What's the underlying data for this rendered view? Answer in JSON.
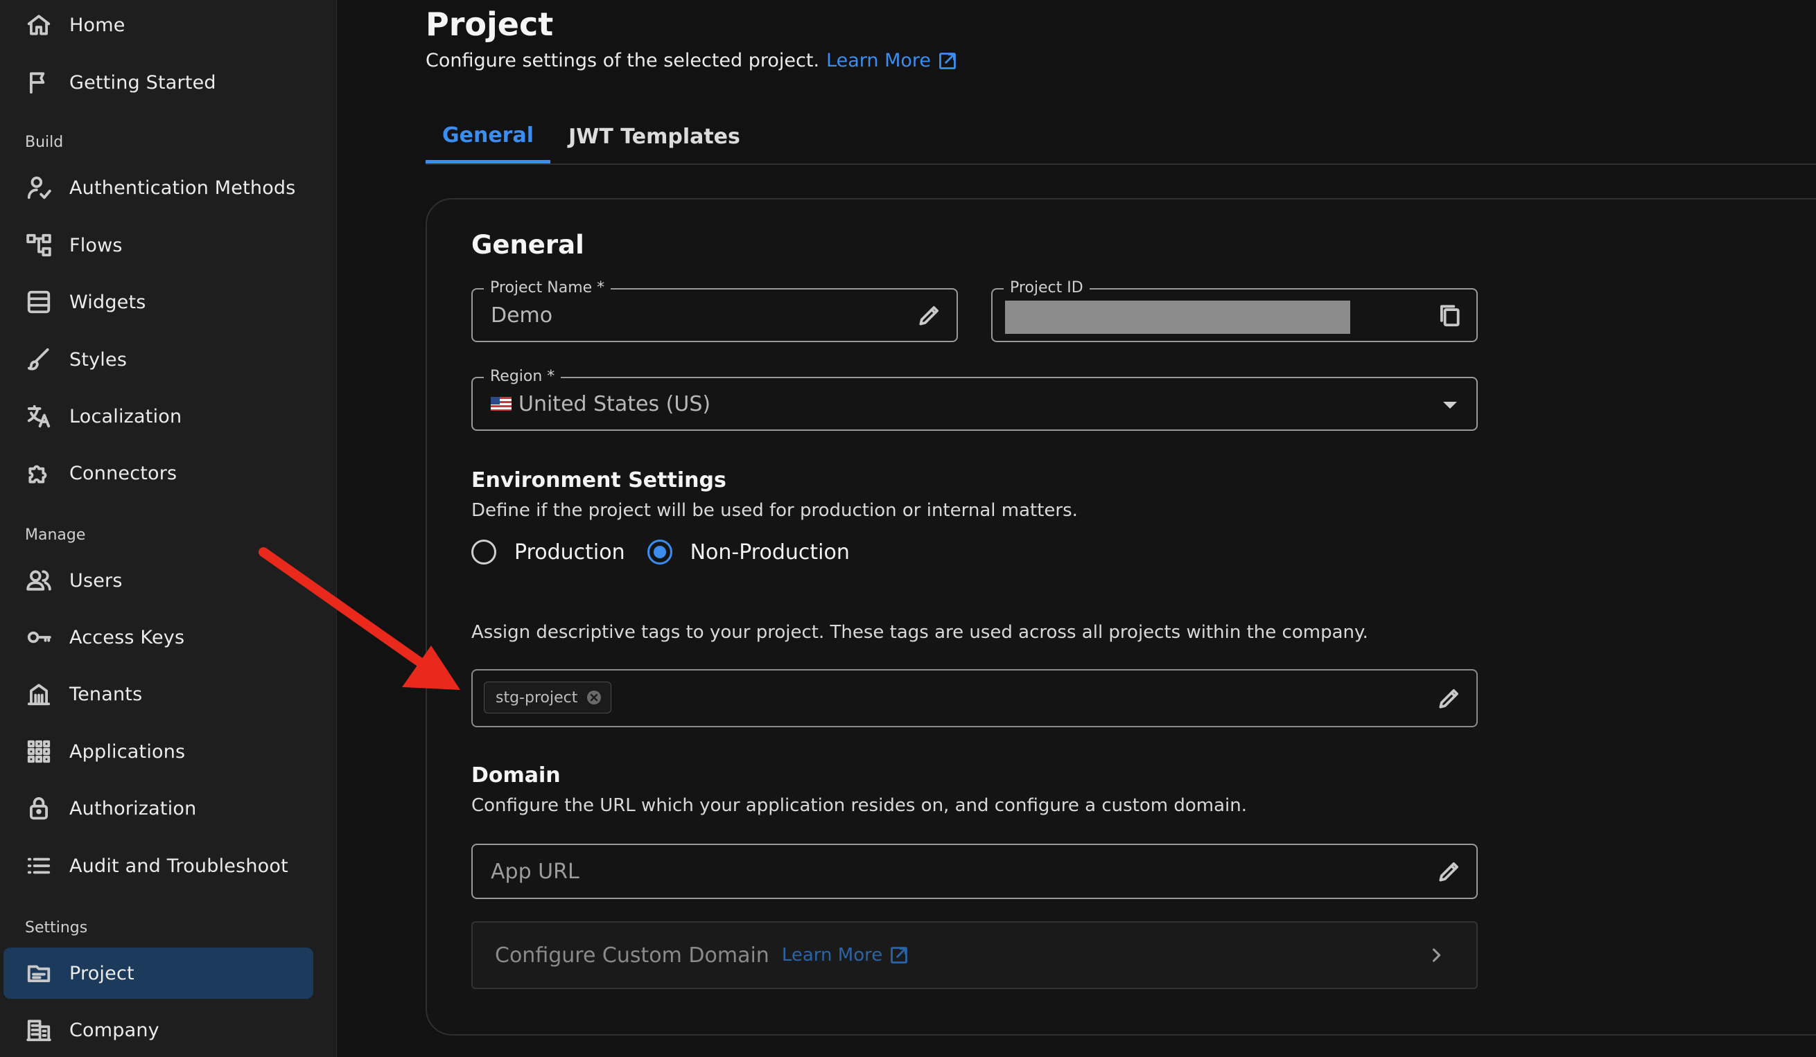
{
  "sidebar": {
    "top_items": [
      {
        "label": "Home",
        "icon": "home-icon"
      },
      {
        "label": "Getting Started",
        "icon": "flag-icon"
      }
    ],
    "sections": [
      {
        "label": "Build",
        "items": [
          {
            "label": "Authentication Methods",
            "icon": "user-check-icon"
          },
          {
            "label": "Flows",
            "icon": "flow-tree-icon"
          },
          {
            "label": "Widgets",
            "icon": "widget-list-icon"
          },
          {
            "label": "Styles",
            "icon": "brush-icon"
          },
          {
            "label": "Localization",
            "icon": "translate-icon"
          },
          {
            "label": "Connectors",
            "icon": "puzzle-icon"
          }
        ]
      },
      {
        "label": "Manage",
        "items": [
          {
            "label": "Users",
            "icon": "users-icon"
          },
          {
            "label": "Access Keys",
            "icon": "key-icon"
          },
          {
            "label": "Tenants",
            "icon": "building-columns-icon"
          },
          {
            "label": "Applications",
            "icon": "grid-icon"
          },
          {
            "label": "Authorization",
            "icon": "lock-icon"
          },
          {
            "label": "Audit and Troubleshoot",
            "icon": "list-icon"
          }
        ]
      },
      {
        "label": "Settings",
        "items": [
          {
            "label": "Project",
            "icon": "folder-icon",
            "active": true
          },
          {
            "label": "Company",
            "icon": "company-icon"
          }
        ]
      }
    ]
  },
  "header": {
    "title": "Project",
    "subtitle": "Configure settings of the selected project.",
    "learn_more": "Learn More"
  },
  "tabs": [
    {
      "label": "General",
      "active": true
    },
    {
      "label": "JWT Templates",
      "active": false
    }
  ],
  "general": {
    "title": "General",
    "project_name": {
      "label": "Project Name *",
      "value": "Demo"
    },
    "project_id": {
      "label": "Project ID",
      "value": ""
    },
    "region": {
      "label": "Region *",
      "value": "United States (US)"
    },
    "environment": {
      "title": "Environment Settings",
      "description": "Define if the project will be used for production or internal matters.",
      "options": [
        {
          "label": "Production",
          "checked": false
        },
        {
          "label": "Non-Production",
          "checked": true
        }
      ]
    },
    "tags": {
      "description": "Assign descriptive tags to your project. These tags are used across all projects within the company.",
      "chips": [
        "stg-project"
      ]
    },
    "domain": {
      "title": "Domain",
      "description": "Configure the URL which your application resides on, and configure a custom domain.",
      "app_url_placeholder": "App URL",
      "custom_domain_label": "Configure Custom Domain",
      "custom_domain_link": "Learn More"
    }
  },
  "colors": {
    "accent": "#3b8ef0",
    "annotation_arrow": "#e8291c",
    "active_nav_bg": "#1c3a5c"
  }
}
